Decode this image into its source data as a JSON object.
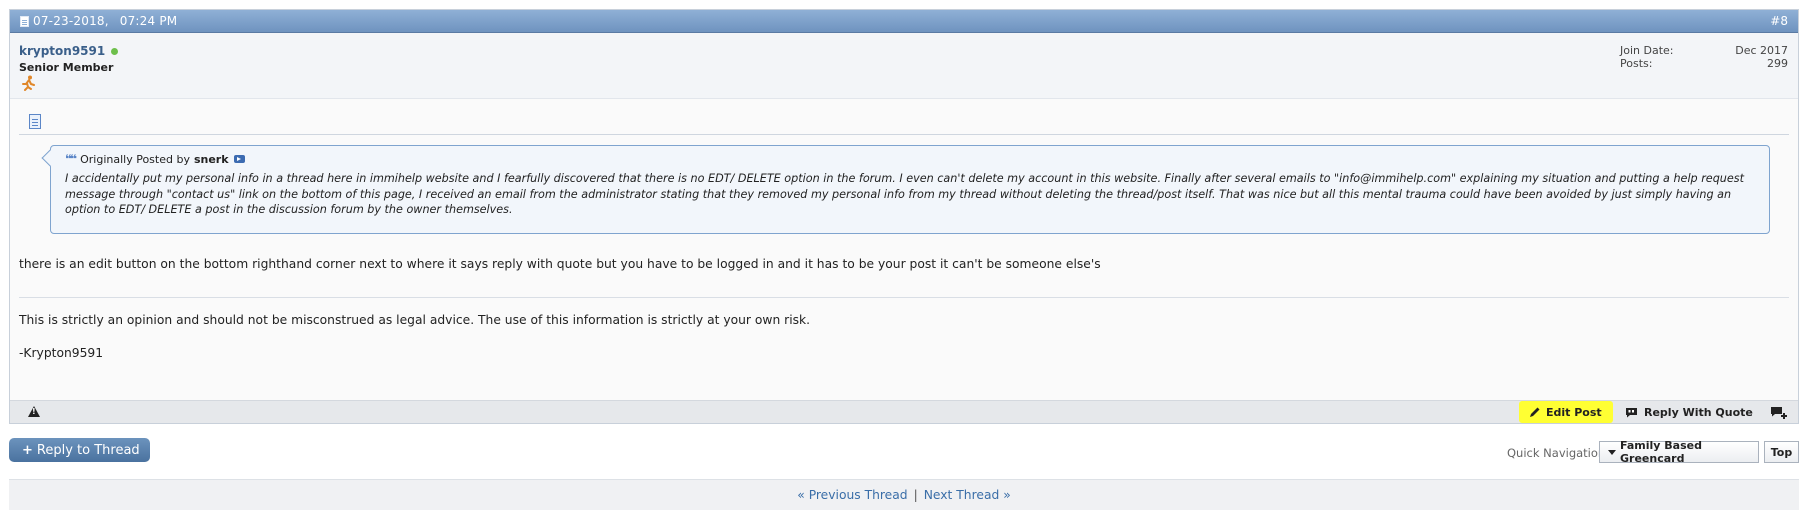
{
  "post": {
    "date": "07-23-2018,",
    "time": "07:24 PM",
    "number": "#8",
    "username": "krypton9591",
    "user_title": "Senior Member",
    "join_date_label": "Join Date:",
    "join_date_value": "Dec 2017",
    "posts_label": "Posts:",
    "posts_value": "299",
    "quote": {
      "prefix": "Originally Posted by",
      "author": "snerk",
      "text": "I accidentally put my personal info in a thread here in immihelp website and I fearfully discovered that there is no EDT/ DELETE option in the forum. I even can't delete my account in this website. Finally after several emails to \"info@immihelp.com\" explaining my situation and putting a help request message through \"contact us\" link on the bottom of this page, I received an email from the administrator stating that they removed my personal info from my thread without deleting the thread/post itself. That was nice but all this mental trauma could have been avoided by just simply having an option to EDT/ DELETE a post in the discussion forum by the owner themselves."
    },
    "body": "there is an edit button on the bottom righthand corner next to where it says reply with quote but you have to be logged in and it has to be your post it can't be someone else's",
    "signature": "This is strictly an opinion and should not be misconstrued as legal advice. The use of this information is strictly at your own risk.",
    "signature_name": "-Krypton9591",
    "footer": {
      "edit_label": "Edit Post",
      "reply_quote_label": "Reply With Quote",
      "highlight_color": "#ffff33"
    }
  },
  "reply_button_label": "Reply to Thread",
  "reply_button_plus": "+",
  "quick_nav": {
    "label": "Quick Navigation",
    "selected": "Family Based Greencard",
    "top_label": "Top"
  },
  "thread_nav": {
    "previous": "« Previous Thread",
    "separator": "|",
    "next": "Next Thread »"
  }
}
